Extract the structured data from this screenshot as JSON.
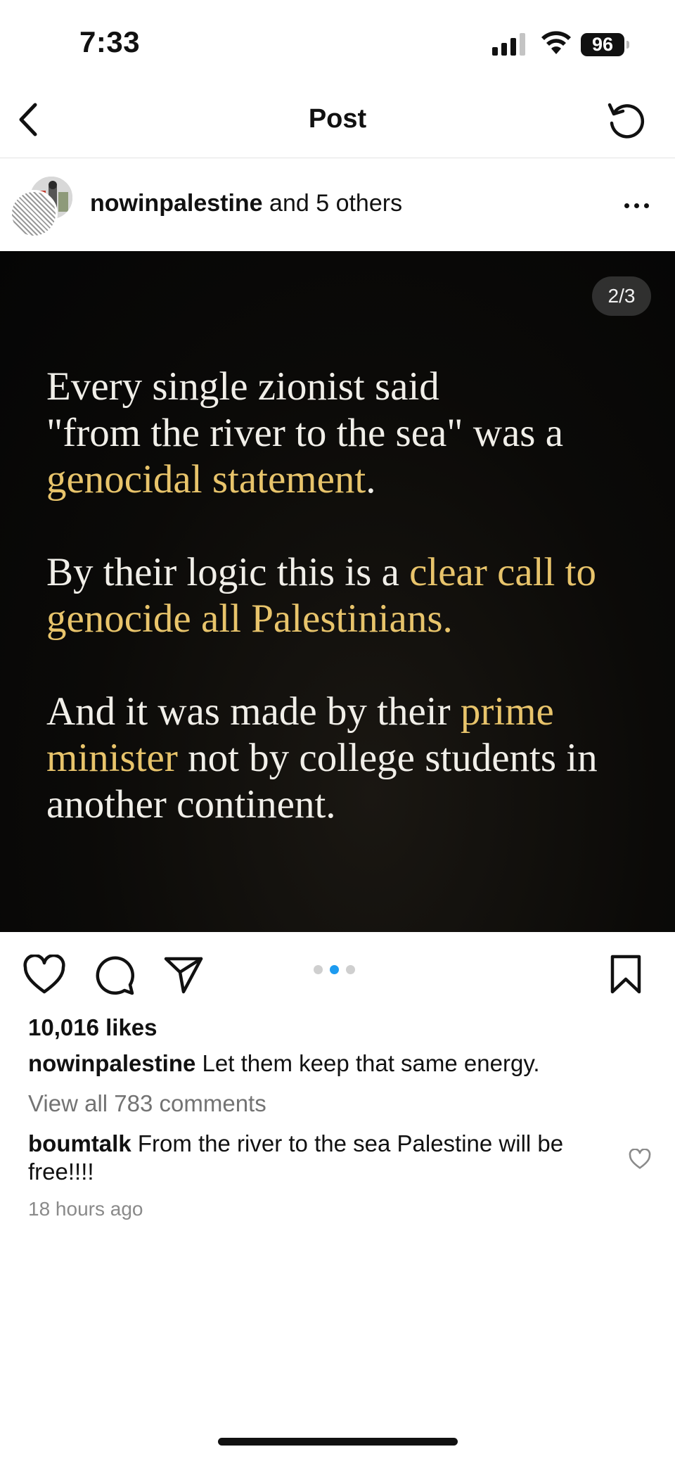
{
  "status_bar": {
    "time": "7:33",
    "battery": "96"
  },
  "nav": {
    "title": "Post",
    "back_icon": "chevron-left-icon",
    "refresh_icon": "refresh-icon"
  },
  "author": {
    "username": "nowinpalestine",
    "collaborators_text": "and 5 others"
  },
  "media": {
    "page_counter": "2/3",
    "paragraphs": [
      {
        "parts": [
          {
            "text": "Every single zionist said",
            "highlight": false
          },
          {
            "text": "\"from the river to the sea\" was a",
            "highlight": false
          },
          {
            "text": "genocidal statement",
            "highlight": true
          },
          {
            "text": ".",
            "highlight": false
          }
        ]
      },
      {
        "parts": [
          {
            "text": "By their logic this is a ",
            "highlight": false
          },
          {
            "text": "clear call to genocide all Palestinians.",
            "highlight": true
          }
        ]
      },
      {
        "parts": [
          {
            "text": "And it was made by their ",
            "highlight": false
          },
          {
            "text": "prime minister",
            "highlight": true
          },
          {
            "text": " not by college students in another continent.",
            "highlight": false
          }
        ]
      }
    ],
    "highlight_color": "#e8c46b",
    "carousel": {
      "count": 3,
      "active_index": 1
    }
  },
  "actions": {
    "like_icon": "heart-icon",
    "comment_icon": "comment-icon",
    "share_icon": "share-icon",
    "save_icon": "bookmark-icon"
  },
  "engagement": {
    "likes": "10,016 likes",
    "caption_user": "nowinpalestine",
    "caption_text": "Let them keep that same energy.",
    "view_comments": "View all 783 comments"
  },
  "comment": {
    "user": "boumtalk",
    "text": "From the river to the sea Palestine will be free!!!!",
    "time": "18 hours ago"
  }
}
